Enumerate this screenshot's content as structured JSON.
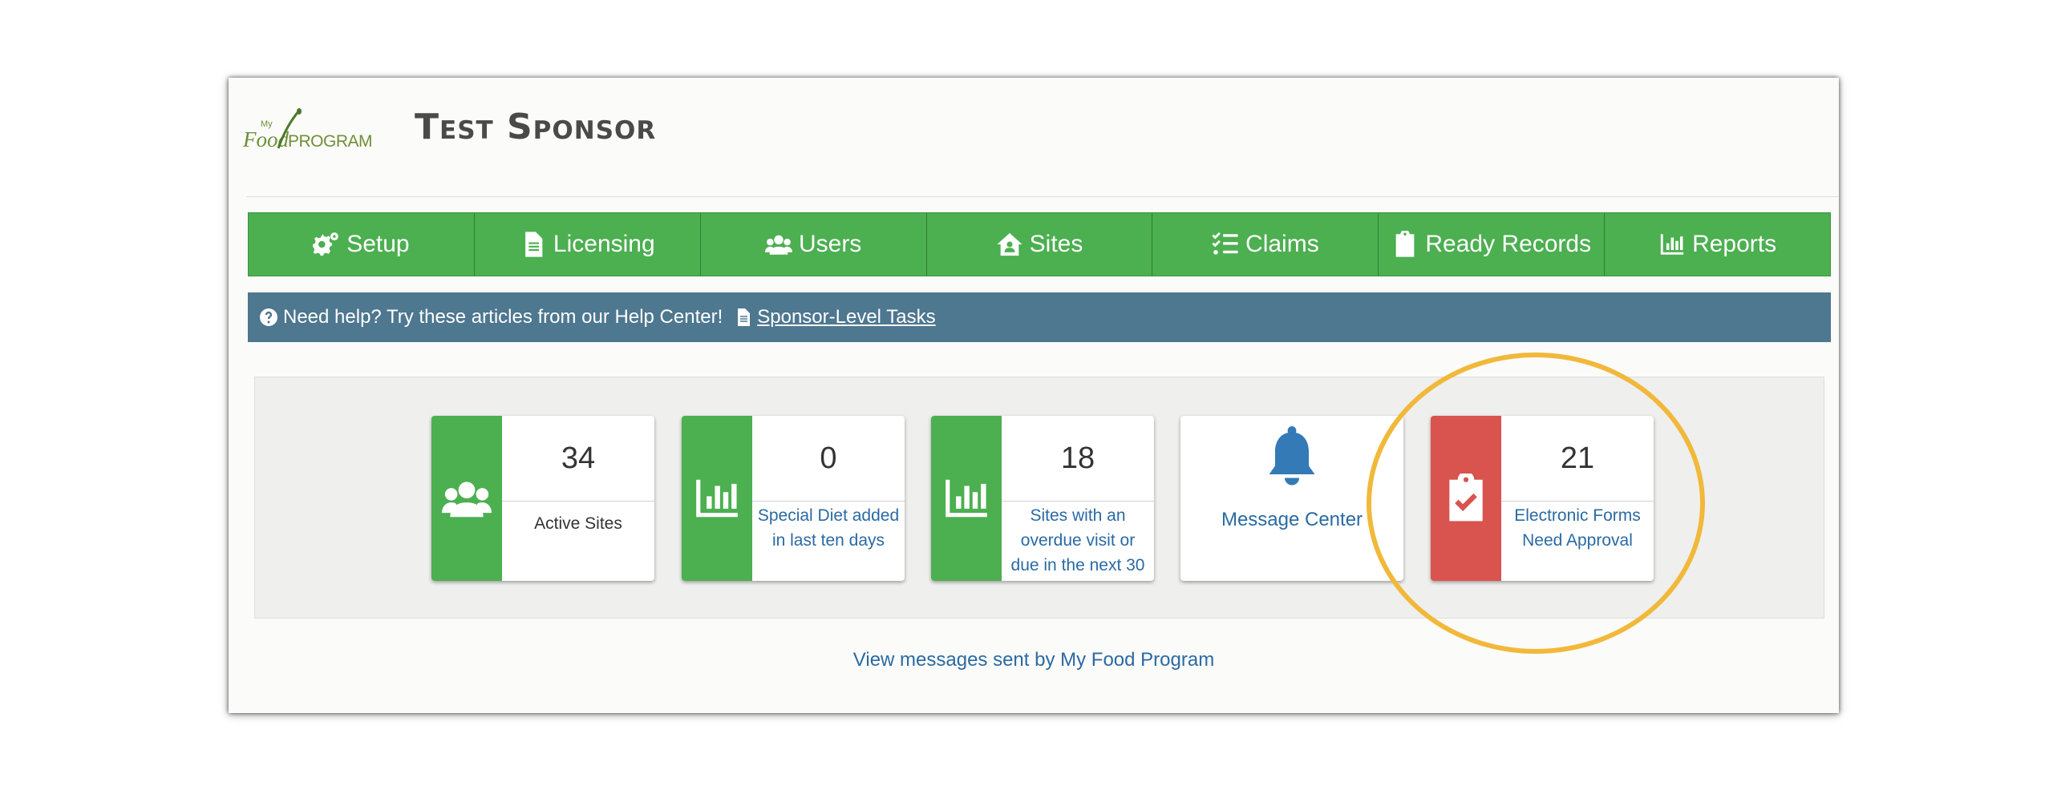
{
  "header": {
    "logo_text_my": "My",
    "logo_text_food": "Food",
    "logo_text_program": "PROGRAM",
    "sponsor_title": "Test Sponsor"
  },
  "nav": {
    "setup": "Setup",
    "licensing": "Licensing",
    "users": "Users",
    "sites": "Sites",
    "claims": "Claims",
    "ready_records": "Ready Records",
    "reports": "Reports"
  },
  "help": {
    "text": "Need help? Try these articles from our Help Center!",
    "link": "Sponsor-Level Tasks"
  },
  "tiles": {
    "active_sites": {
      "count": "34",
      "label": "Active Sites"
    },
    "special_diet": {
      "count": "0",
      "label": "Special Diet added in last ten days"
    },
    "overdue_visit": {
      "count": "18",
      "label": "Sites with an overdue visit or due in the next 30"
    },
    "message_center": {
      "label": "Message Center"
    },
    "electronic_forms": {
      "count": "21",
      "label": "Electronic Forms Need Approval"
    }
  },
  "footer": {
    "view_messages": "View messages sent by My Food Program"
  },
  "colors": {
    "nav_green": "#4caf50",
    "help_bar": "#4e7790",
    "alert_red": "#d9534f",
    "link_blue": "#2a6aa3",
    "highlight": "#f1b83a"
  }
}
